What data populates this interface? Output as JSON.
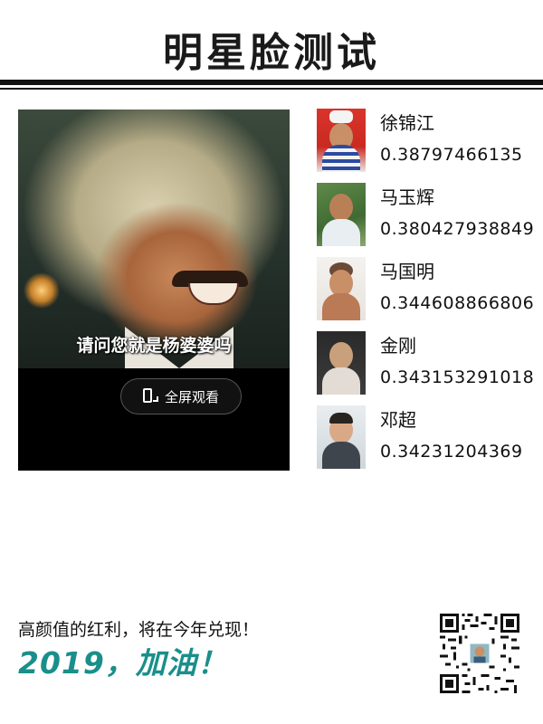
{
  "header": {
    "title": "明星脸测试"
  },
  "photo": {
    "subtitle": "请问您就是杨婆婆吗",
    "fullscreen_label": "全屏观看"
  },
  "results": [
    {
      "name": "徐锦江",
      "score": "0.38797466135"
    },
    {
      "name": "马玉辉",
      "score": "0.380427938849"
    },
    {
      "name": "马国明",
      "score": "0.344608866806"
    },
    {
      "name": "金刚",
      "score": "0.343153291018"
    },
    {
      "name": "邓超",
      "score": "0.34231204369"
    }
  ],
  "footer": {
    "tagline": "高颜值的红利，将在今年兑现！",
    "cheer": "2019，加油！"
  },
  "colors": {
    "accent": "#1a8f8a",
    "text": "#111111",
    "background": "#ffffff"
  },
  "icons": {
    "fullscreen": "phone-fullscreen-icon",
    "qr": "qr-code"
  }
}
